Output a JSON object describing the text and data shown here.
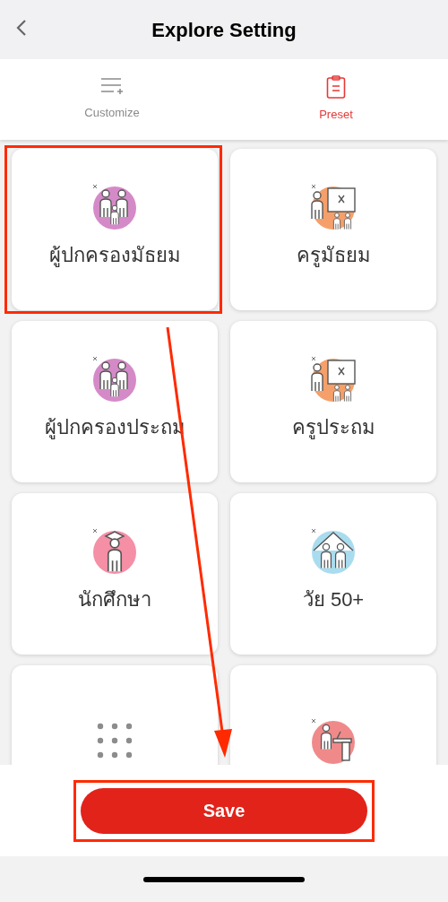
{
  "header": {
    "title": "Explore Setting"
  },
  "tabs": [
    {
      "label": "Customize",
      "kind": "list",
      "selected": false
    },
    {
      "label": "Preset",
      "kind": "clipboard",
      "selected": true
    }
  ],
  "presets": [
    {
      "label": "ผู้ปกครองมัธยม",
      "kind": "family",
      "highlighted": true
    },
    {
      "label": "ครูมัธยม",
      "kind": "teacher",
      "highlighted": false
    },
    {
      "label": "ผู้ปกครองประถม",
      "kind": "family",
      "highlighted": false
    },
    {
      "label": "ครูประถม",
      "kind": "teacher",
      "highlighted": false
    },
    {
      "label": "นักศึกษา",
      "kind": "graduate",
      "highlighted": false
    },
    {
      "label": "วัย 50+",
      "kind": "elderly",
      "highlighted": false
    },
    {
      "kind": "grid",
      "highlighted": false
    },
    {
      "kind": "worker",
      "highlighted": false
    }
  ],
  "save_button": {
    "label": "Save",
    "highlighted": true
  },
  "annotation": {
    "arrow": true
  }
}
